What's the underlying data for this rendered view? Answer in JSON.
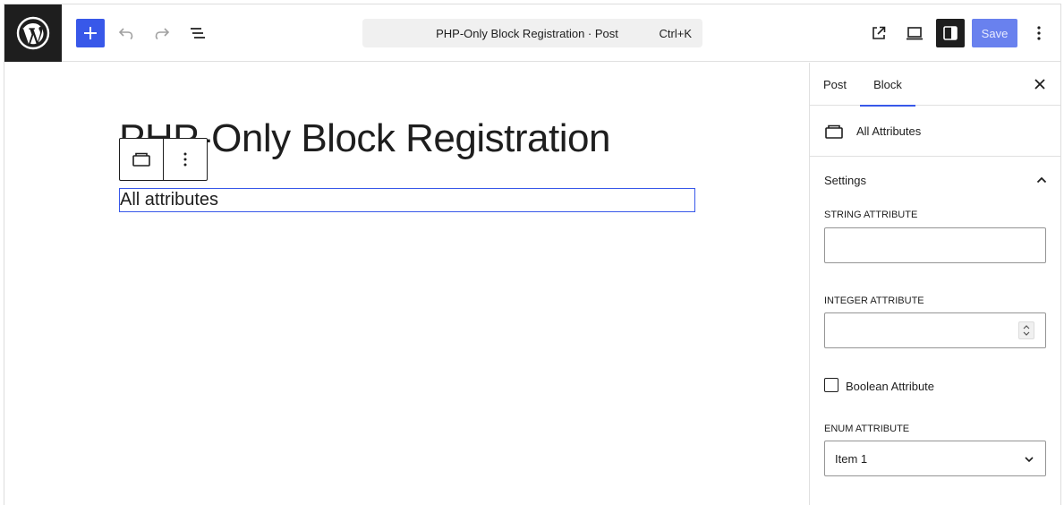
{
  "topbar": {
    "document_title": "PHP-Only Block Registration · Post",
    "shortcut": "Ctrl+K",
    "save_label": "Save"
  },
  "canvas": {
    "post_title": "PHP-Only Block Registration",
    "selected_block_text": "All attributes"
  },
  "sidebar": {
    "tabs": [
      {
        "label": "Post"
      },
      {
        "label": "Block"
      }
    ],
    "active_tab": "Block",
    "block_card_title": "All Attributes",
    "panel": {
      "title": "Settings",
      "string_label": "STRING ATTRIBUTE",
      "string_value": "",
      "integer_label": "INTEGER ATTRIBUTE",
      "integer_value": "",
      "boolean_label": "Boolean Attribute",
      "boolean_checked": false,
      "enum_label": "ENUM ATTRIBUTE",
      "enum_selected": "Item 1"
    }
  },
  "icons": {
    "logo": "wordpress-logo-icon",
    "inserter": "plus-icon",
    "undo": "undo-icon",
    "redo": "redo-icon",
    "document_overview": "list-view-icon",
    "view_post": "external-link-icon",
    "device_preview": "desktop-icon",
    "settings": "sidebar-toggle-icon",
    "more": "more-vertical-icon",
    "block": "block-icon",
    "close": "close-icon",
    "collapse": "chevron-up-icon",
    "select": "chevron-down-icon"
  },
  "colors": {
    "accent": "#3858e9",
    "dark": "#1e1e1e",
    "border": "#e0e0e0"
  }
}
